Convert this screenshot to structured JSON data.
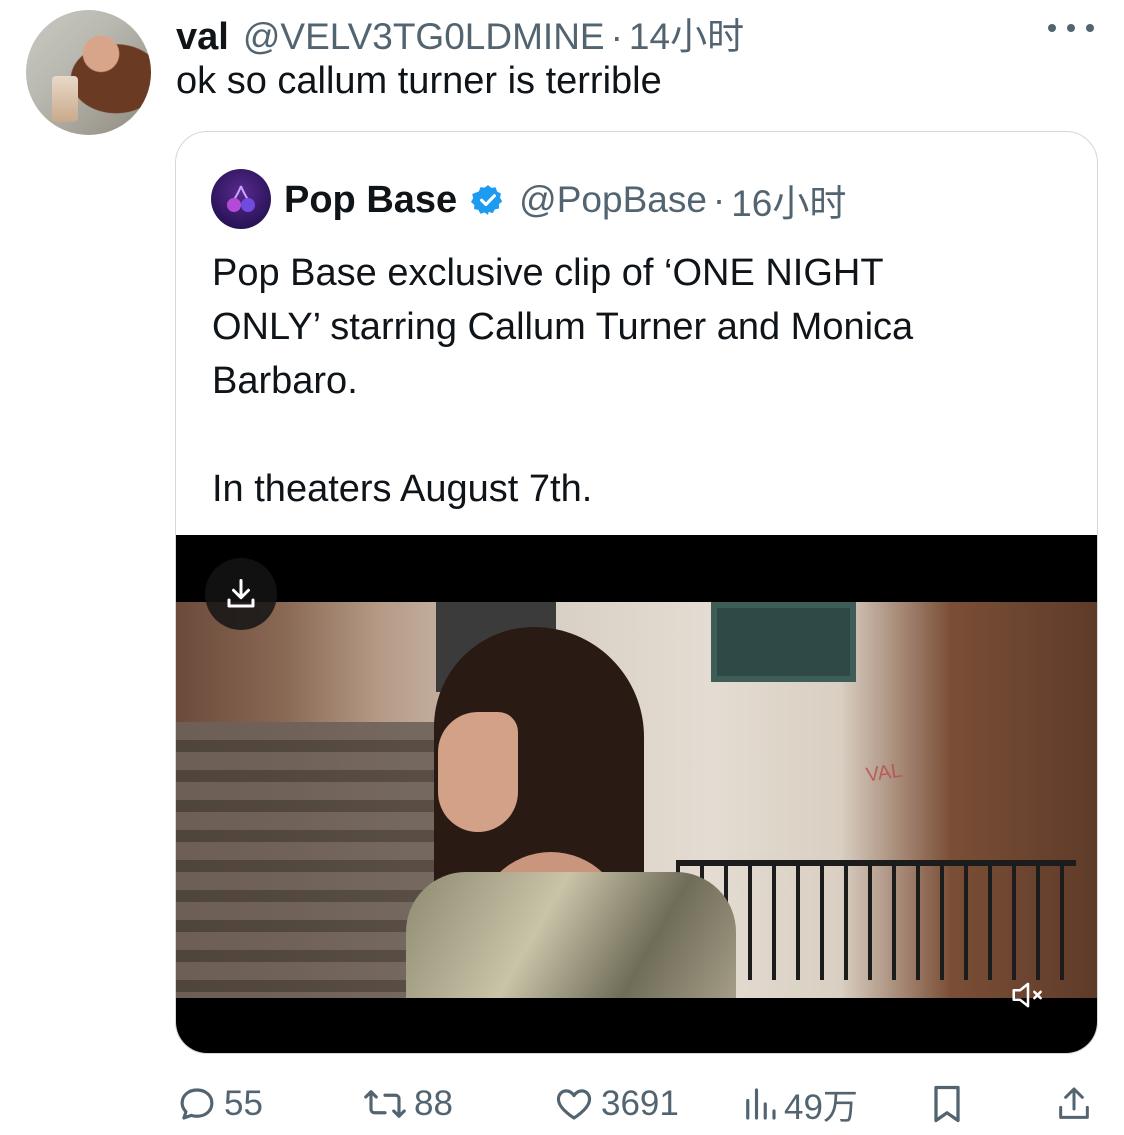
{
  "tweet": {
    "author_name": "val",
    "author_handle": "@VELV3TG0LDMINE",
    "separator": "·",
    "time": "14小时",
    "text": "ok so callum turner is terrible"
  },
  "quote": {
    "author_name": "Pop Base",
    "author_handle": "@PopBase",
    "separator": "·",
    "time": "16小时",
    "text_line1": "Pop Base exclusive clip of ‘ONE NIGHT",
    "text_line2": "ONLY’ starring Callum Turner and Monica",
    "text_line3": "Barbaro.",
    "text_line4": "In theaters August 7th.",
    "verified": true
  },
  "video": {
    "download_icon": "download-icon",
    "mute_icon": "volume-muted-icon",
    "graffiti_text": "VAL"
  },
  "actions": {
    "replies": "55",
    "retweets": "88",
    "likes": "3691",
    "views": "49万"
  },
  "colors": {
    "text_primary": "#0f1419",
    "text_secondary": "#536471",
    "verified_blue": "#1d9bf0",
    "card_border": "#cfd9de"
  }
}
